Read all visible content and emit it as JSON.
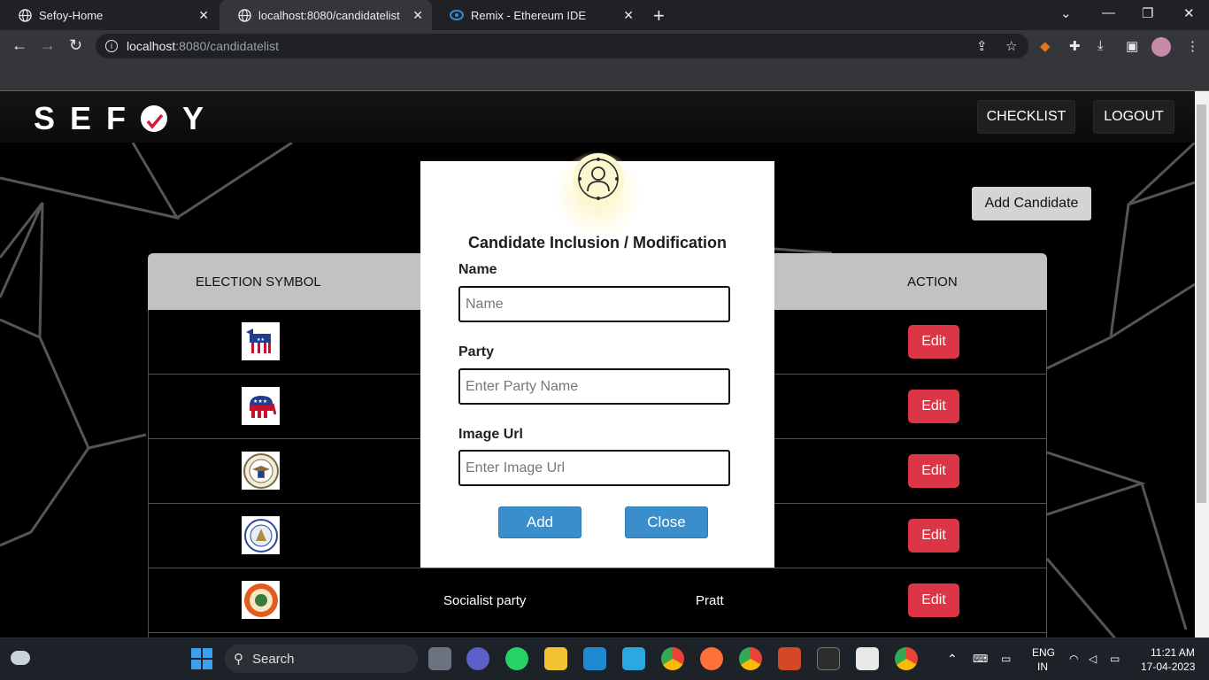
{
  "browser": {
    "tabs": [
      {
        "title": "Sefoy-Home",
        "icon": "globe-icon"
      },
      {
        "title": "localhost:8080/candidatelist",
        "icon": "globe-icon"
      },
      {
        "title": "Remix - Ethereum IDE",
        "icon": "remix-icon"
      }
    ],
    "new_tab": "+",
    "url_host": "localhost",
    "url_path": ":8080/candidatelist"
  },
  "header": {
    "logo": "SEF",
    "logo_end": "Y",
    "checklist": "CHECKLIST",
    "logout": "LOGOUT"
  },
  "add_candidate": "Add Candidate",
  "table": {
    "col_symbol": "ELECTION SYMBOL",
    "col_action": "ACTION",
    "rows": [
      {
        "symbol": "donkey-symbol",
        "party": "",
        "name": "",
        "action": "Edit"
      },
      {
        "symbol": "elephant-symbol",
        "party": "",
        "name": "",
        "action": "Edit"
      },
      {
        "symbol": "eagle-seal-symbol",
        "party": "",
        "name": "",
        "action": "Edit"
      },
      {
        "symbol": "seal-symbol",
        "party": "",
        "name": "",
        "action": "Edit"
      },
      {
        "symbol": "orange-seal-symbol",
        "party": "Socialist party",
        "name": "Pratt",
        "action": "Edit"
      }
    ]
  },
  "modal": {
    "title": "Candidate Inclusion / Modification",
    "name_label": "Name",
    "name_placeholder": "Name",
    "party_label": "Party",
    "party_placeholder": "Enter Party Name",
    "image_label": "Image Url",
    "image_placeholder": "Enter Image Url",
    "add": "Add",
    "close": "Close"
  },
  "taskbar": {
    "search": "Search",
    "lang1": "ENG",
    "lang2": "IN",
    "time": "11:21 AM",
    "date": "17-04-2023"
  },
  "colors": {
    "edit": "#dc3545",
    "modal_btn": "#3a8ecb"
  }
}
